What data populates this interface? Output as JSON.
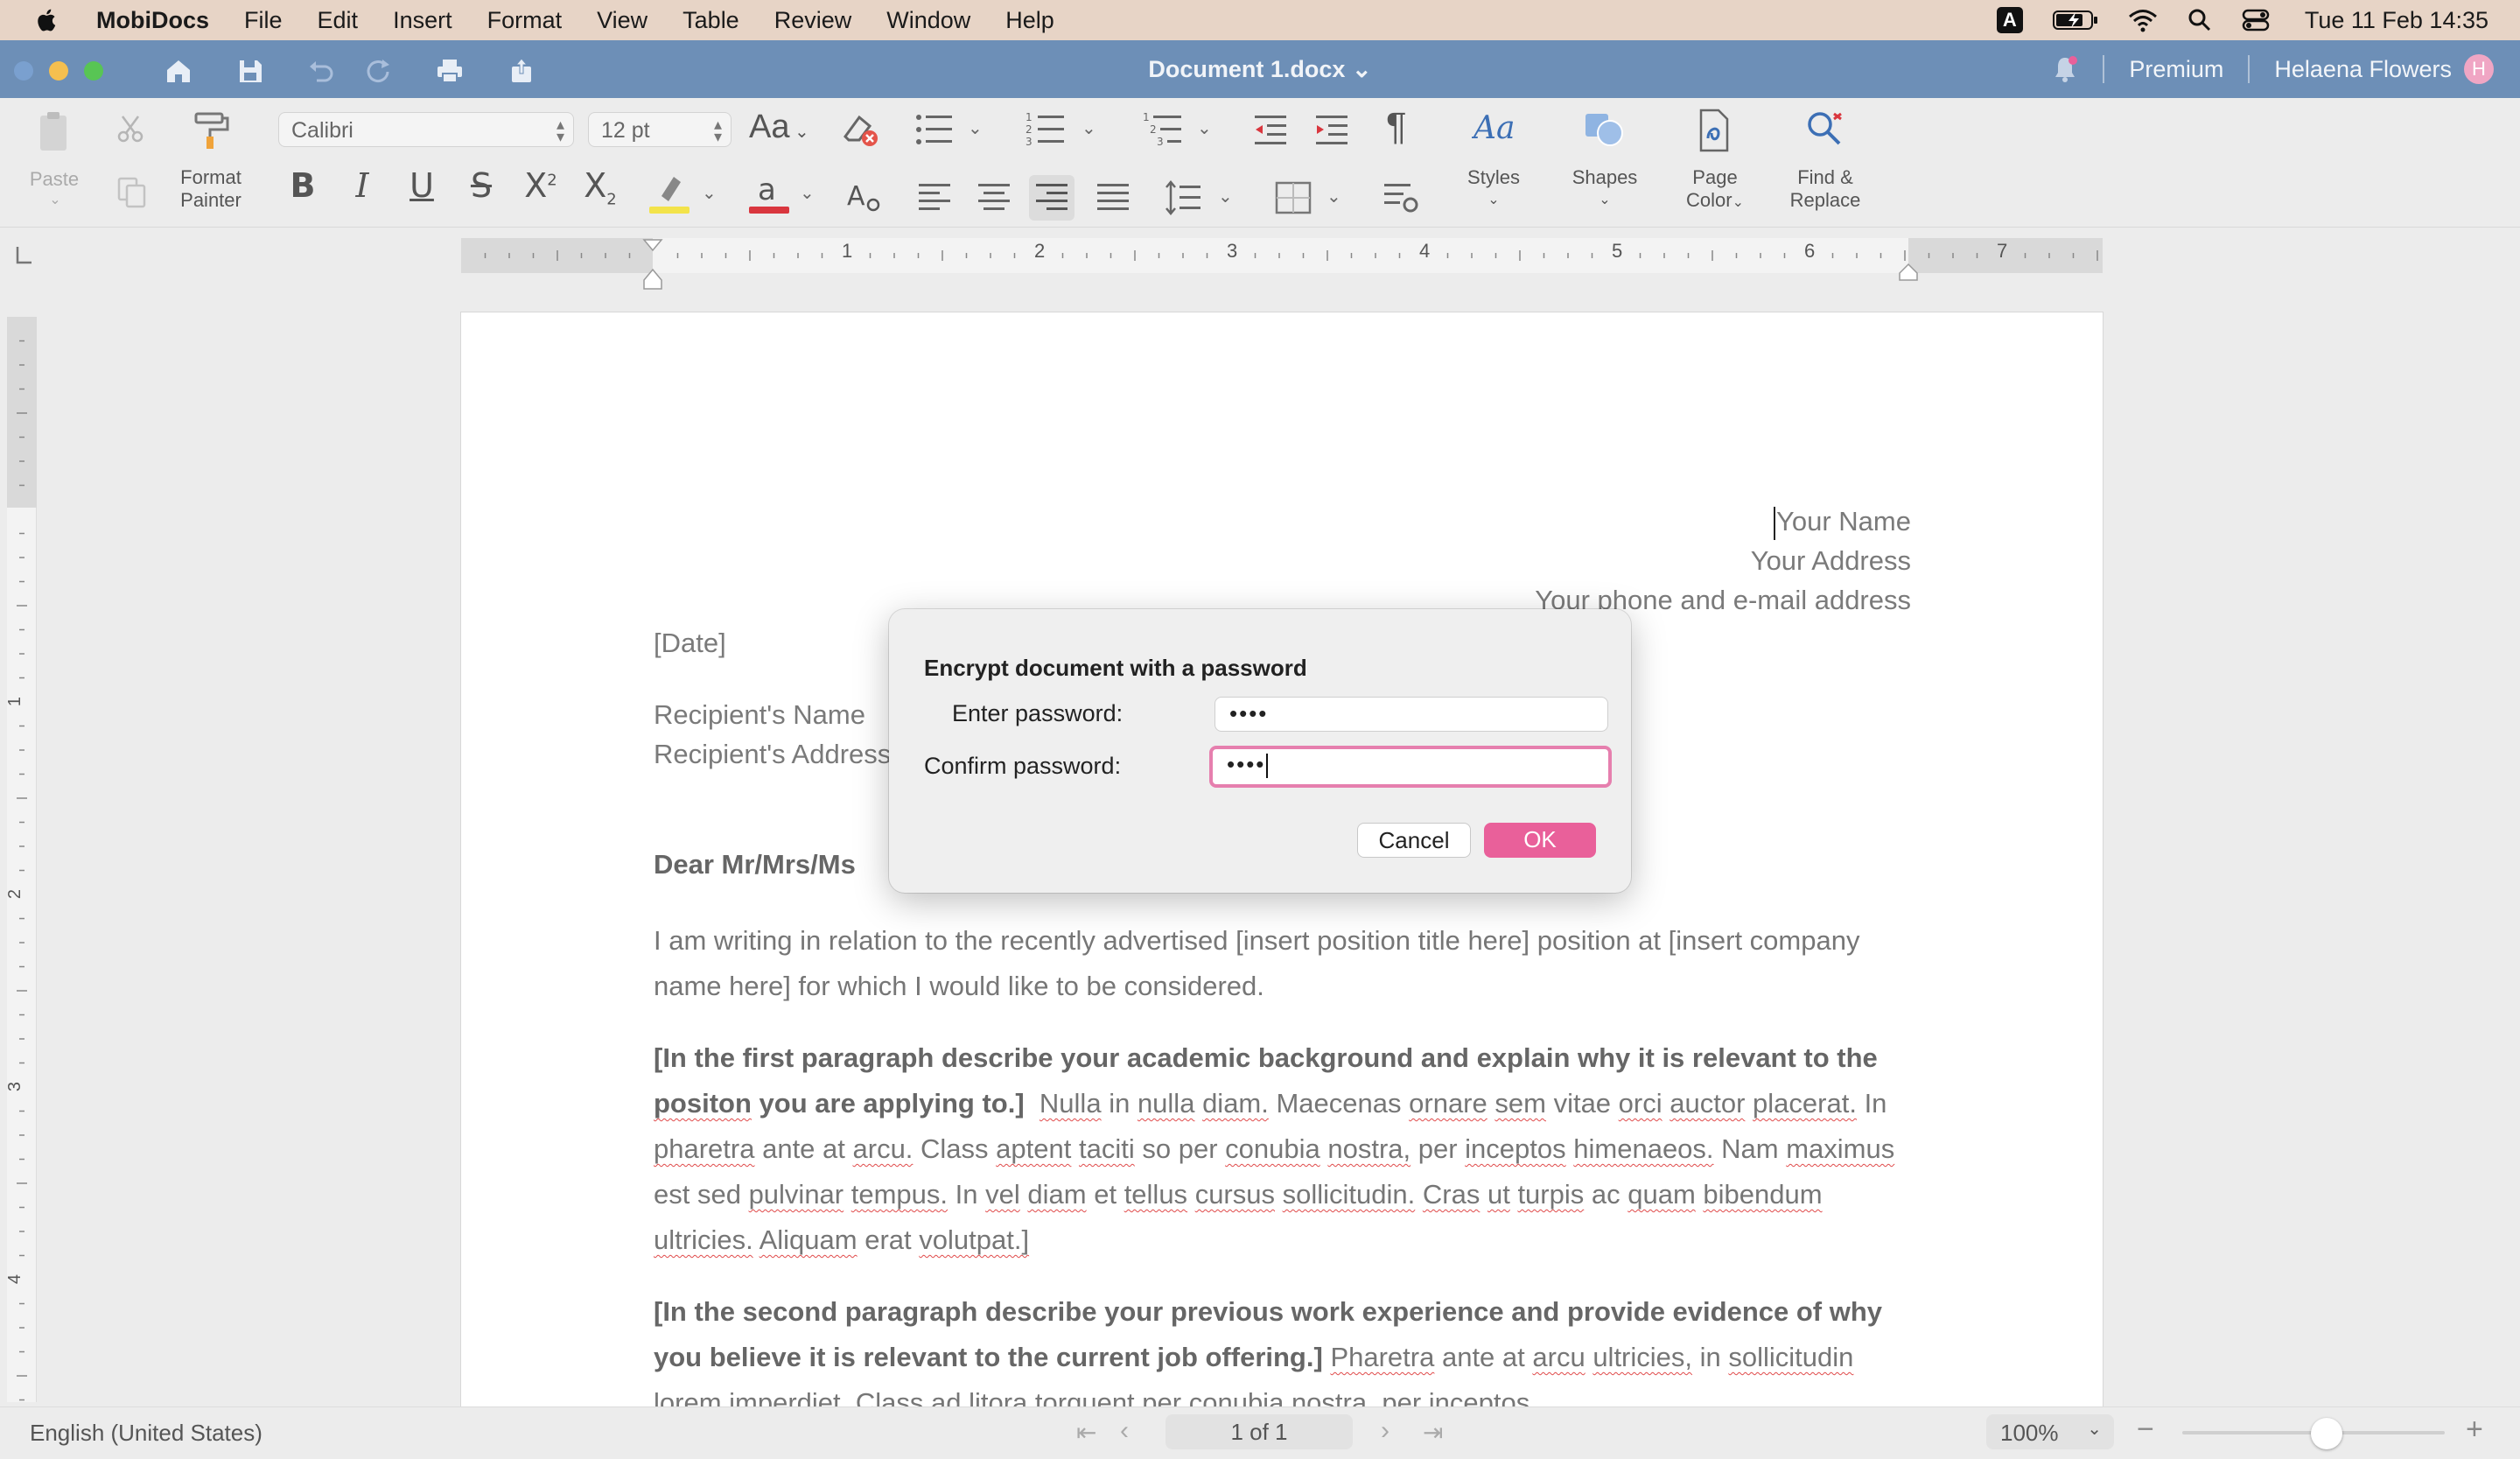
{
  "menubar": {
    "app_name": "MobiDocs",
    "items": [
      "File",
      "Edit",
      "Insert",
      "Format",
      "View",
      "Table",
      "Review",
      "Window",
      "Help"
    ],
    "clock": "Tue 11 Feb  14:35",
    "input_badge": "A"
  },
  "titlebar": {
    "document_title": "Document 1.docx",
    "premium_label": "Premium",
    "user_name": "Helaena Flowers",
    "user_initial": "H"
  },
  "ribbon": {
    "paste_label": "Paste",
    "format_painter_label": [
      "Format",
      "Painter"
    ],
    "font_name": "Calibri",
    "font_size": "12 pt",
    "change_case_label": "Aa",
    "styles_label": "Styles",
    "shapes_label": "Shapes",
    "page_color_label": [
      "Page",
      "Color"
    ],
    "find_replace_label": [
      "Find &",
      "Replace"
    ],
    "bold": "B",
    "italic": "I",
    "underline": "U",
    "strike": "S",
    "pilcrow": "¶"
  },
  "ruler": {
    "numbers": [
      "1",
      "2",
      "3",
      "4",
      "5",
      "6",
      "7"
    ],
    "vertical_numbers": [
      "1",
      "2",
      "3",
      "4"
    ]
  },
  "document": {
    "your_name": "Your Name",
    "your_address": "Your Address",
    "your_contact": "Your phone and e-mail address",
    "date": "[Date]",
    "recipient_name": "Recipient's Name",
    "recipient_address": "Recipient's Address",
    "salutation": "Dear Mr/Mrs/Ms",
    "para1": "I am writing in relation to the recently advertised [insert position title here] position at [insert company name here] for which I would like to be considered.",
    "para2_bold": "[In the first paragraph describe your academic background and explain why it is relevant to the positon you are applying to.]",
    "para2_rest": "Nulla in nulla diam. Maecenas ornare sem vitae orci auctor placerat. In pharetra ante at arcu. Class aptent taciti so per conubia nostra, per inceptos himenaeos. Nam maximus est sed pulvinar tempus. In vel diam et tellus cursus sollicitudin. Cras ut turpis ac quam bibendum ultricies. Aliquam erat volutpat.]",
    "para3_bold": "[In the second paragraph describe your previous work experience and provide evidence of why you believe it is relevant to the current job offering.]",
    "para3_rest": "Pharetra ante at arcu ultricies, in sollicitudin lorem imperdiet. Class ad litora torquent per conubia nostra, per inceptos"
  },
  "dialog": {
    "title": "Encrypt document with a password",
    "enter_label": "Enter password:",
    "enter_value": "••••",
    "confirm_label": "Confirm password:",
    "confirm_value": "••••",
    "cancel_label": "Cancel",
    "ok_label": "OK"
  },
  "status": {
    "language": "English (United States)",
    "page_indicator": "1 of 1",
    "zoom": "100%",
    "zoom_level": 0.55
  },
  "colors": {
    "menubar_bg": "#e7d4c6",
    "titlebar_bg": "#6d8fb7",
    "accent_pink": "#e9609a",
    "focus_ring": "#e67fae"
  }
}
